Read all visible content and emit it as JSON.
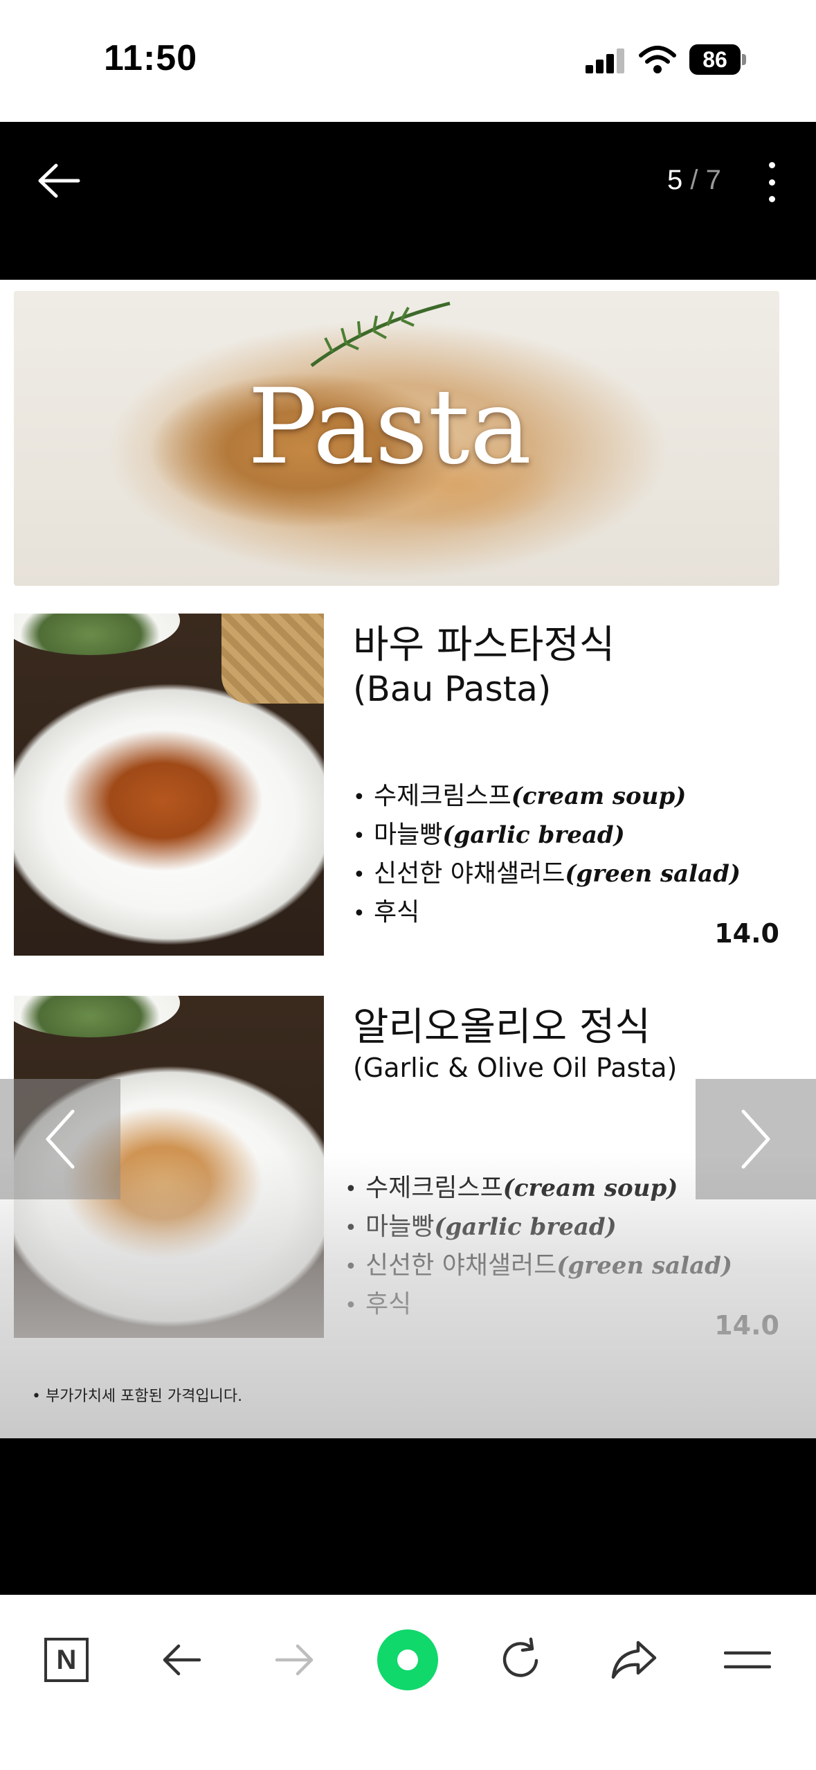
{
  "status_bar": {
    "time": "11:50",
    "battery": "86"
  },
  "viewer": {
    "current_page": "5",
    "separator": "/",
    "total_pages": "7"
  },
  "menu_image": {
    "hero_title": "Pasta",
    "items": [
      {
        "name_ko": "바우 파스타정식",
        "name_en": "(Bau Pasta)",
        "inclusions": [
          {
            "ko": "수제크림스프",
            "en": "(cream soup)"
          },
          {
            "ko": "마늘빵",
            "en": "(garlic bread)"
          },
          {
            "ko": "신선한 야채샐러드",
            "en": "(green salad)"
          },
          {
            "ko": "후식",
            "en": ""
          }
        ],
        "price": "14.0"
      },
      {
        "name_ko": "알리오올리오 정식",
        "name_en": "(Garlic & Olive Oil Pasta)",
        "inclusions": [
          {
            "ko": "수제크림스프",
            "en": "(cream soup)"
          },
          {
            "ko": "마늘빵",
            "en": "(garlic bread)"
          },
          {
            "ko": "신선한 야채샐러드",
            "en": "(green salad)"
          },
          {
            "ko": "후식",
            "en": ""
          }
        ],
        "price": "14.0"
      }
    ],
    "footnote": "• 부가가치세 포함된 가격입니다."
  },
  "toolbar": {
    "naver_label": "N"
  },
  "icons": {
    "back": "back-arrow-icon",
    "more": "more-vertical-icon",
    "prev": "chevron-left-icon",
    "next": "chevron-right-icon",
    "toolbar": [
      "naver-home-icon",
      "back-icon",
      "forward-icon",
      "green-dot-icon",
      "reload-icon",
      "share-icon",
      "menu-icon"
    ]
  },
  "colors": {
    "accent_green": "#10d86b",
    "viewer_background": "#000000"
  }
}
